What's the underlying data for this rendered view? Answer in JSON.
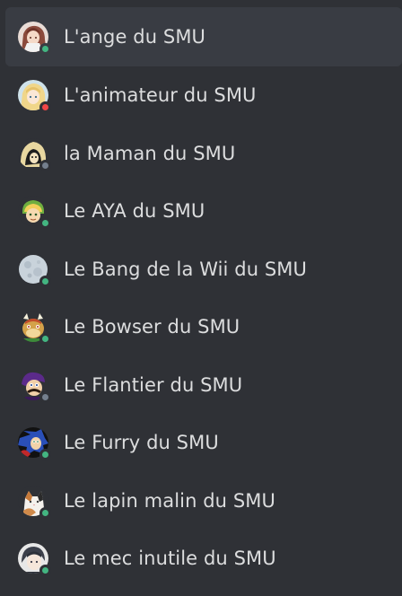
{
  "members": [
    {
      "name": "L'ange du SMU",
      "status": "online",
      "status_color": "#43b581",
      "avatar": "anime-angel-avatar"
    },
    {
      "name": "L'animateur du SMU",
      "status": "dnd",
      "status_color": "#f04747",
      "avatar": "anime-blonde-avatar"
    },
    {
      "name": "la Maman du SMU",
      "status": "offline",
      "status_color": "#747f8d",
      "avatar": "hooded-character-avatar"
    },
    {
      "name": "Le AYA du SMU",
      "status": "online",
      "status_color": "#43b581",
      "avatar": "link-character-avatar"
    },
    {
      "name": "Le Bang de la Wii du SMU",
      "status": "online",
      "status_color": "#43b581",
      "avatar": "moon-avatar"
    },
    {
      "name": "Le Bowser du SMU",
      "status": "online",
      "status_color": "#43b581",
      "avatar": "bowser-avatar"
    },
    {
      "name": "Le Flantier du SMU",
      "status": "offline",
      "status_color": "#747f8d",
      "avatar": "waluigi-avatar"
    },
    {
      "name": "Le Furry du SMU",
      "status": "online",
      "status_color": "#43b581",
      "avatar": "sonic-avatar"
    },
    {
      "name": "Le lapin malin du SMU",
      "status": "online",
      "status_color": "#43b581",
      "avatar": "calico-cat-avatar"
    },
    {
      "name": "Le mec inutile du SMU",
      "status": "online",
      "status_color": "#43b581",
      "avatar": "anime-dark-hair-avatar"
    }
  ]
}
